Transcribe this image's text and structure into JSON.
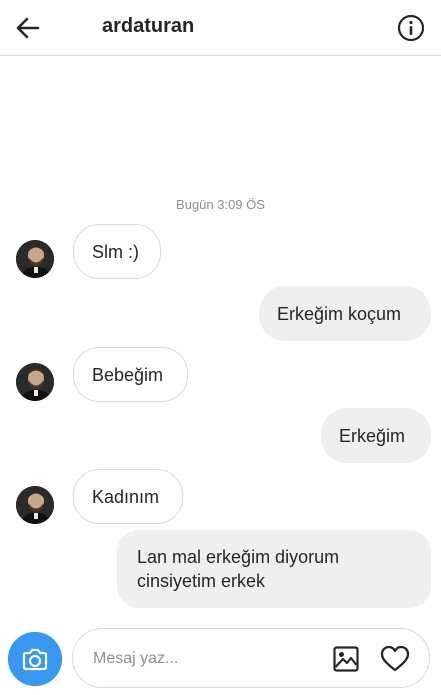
{
  "header": {
    "back_icon": "arrow-left-icon",
    "title": "ardaturan",
    "info_icon": "info-circle-icon"
  },
  "timestamp": "Bugün 3:09 ÖS",
  "messages": [
    {
      "direction": "incoming",
      "text": "Slm :)"
    },
    {
      "direction": "outgoing",
      "text": "Erkeğim koçum"
    },
    {
      "direction": "incoming",
      "text": "Bebeğim"
    },
    {
      "direction": "outgoing",
      "text": "Erkeğim"
    },
    {
      "direction": "incoming",
      "text": "Kadınım"
    },
    {
      "direction": "outgoing",
      "text_line1": "Lan mal erkeğim diyorum",
      "text_line2": "cinsiyetim erkek"
    }
  ],
  "composer": {
    "placeholder": "Mesaj yaz...",
    "camera_icon": "camera-icon",
    "gallery_icon": "image-gallery-icon",
    "like_icon": "heart-icon"
  },
  "colors": {
    "accent": "#3897f0",
    "outgoing_bubble": "#efefef",
    "border": "#dbdbdb",
    "muted_text": "#8e8e8e"
  }
}
